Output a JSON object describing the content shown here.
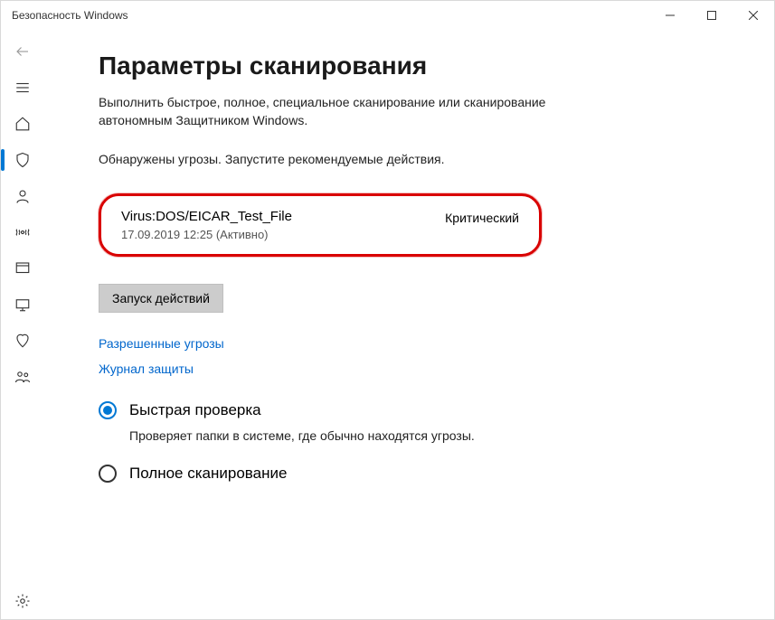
{
  "window": {
    "title": "Безопасность Windows"
  },
  "sidebar": {
    "items": [
      {
        "id": "menu-icon"
      },
      {
        "id": "home-icon"
      },
      {
        "id": "shield-icon",
        "selected": true
      },
      {
        "id": "account-icon"
      },
      {
        "id": "firewall-icon"
      },
      {
        "id": "app-browser-icon"
      },
      {
        "id": "device-security-icon"
      },
      {
        "id": "performance-icon"
      },
      {
        "id": "family-icon"
      }
    ],
    "settings": {
      "id": "settings-icon"
    }
  },
  "page": {
    "title": "Параметры сканирования",
    "subtitle": "Выполнить быстрое, полное, специальное сканирование или сканирование автономным Защитником Windows.",
    "status": "Обнаружены угрозы. Запустите рекомендуемые действия."
  },
  "threat": {
    "name": "Virus:DOS/EICAR_Test_File",
    "timestamp": "17.09.2019 12:25 (Активно)",
    "severity": "Критический"
  },
  "actions": {
    "run_actions": "Запуск действий"
  },
  "links": {
    "allowed_threats": "Разрешенные угрозы",
    "protection_history": "Журнал защиты"
  },
  "scan_options": {
    "quick": {
      "label": "Быстрая проверка",
      "desc": "Проверяет папки в системе, где обычно находятся угрозы."
    },
    "full": {
      "label": "Полное сканирование"
    }
  }
}
